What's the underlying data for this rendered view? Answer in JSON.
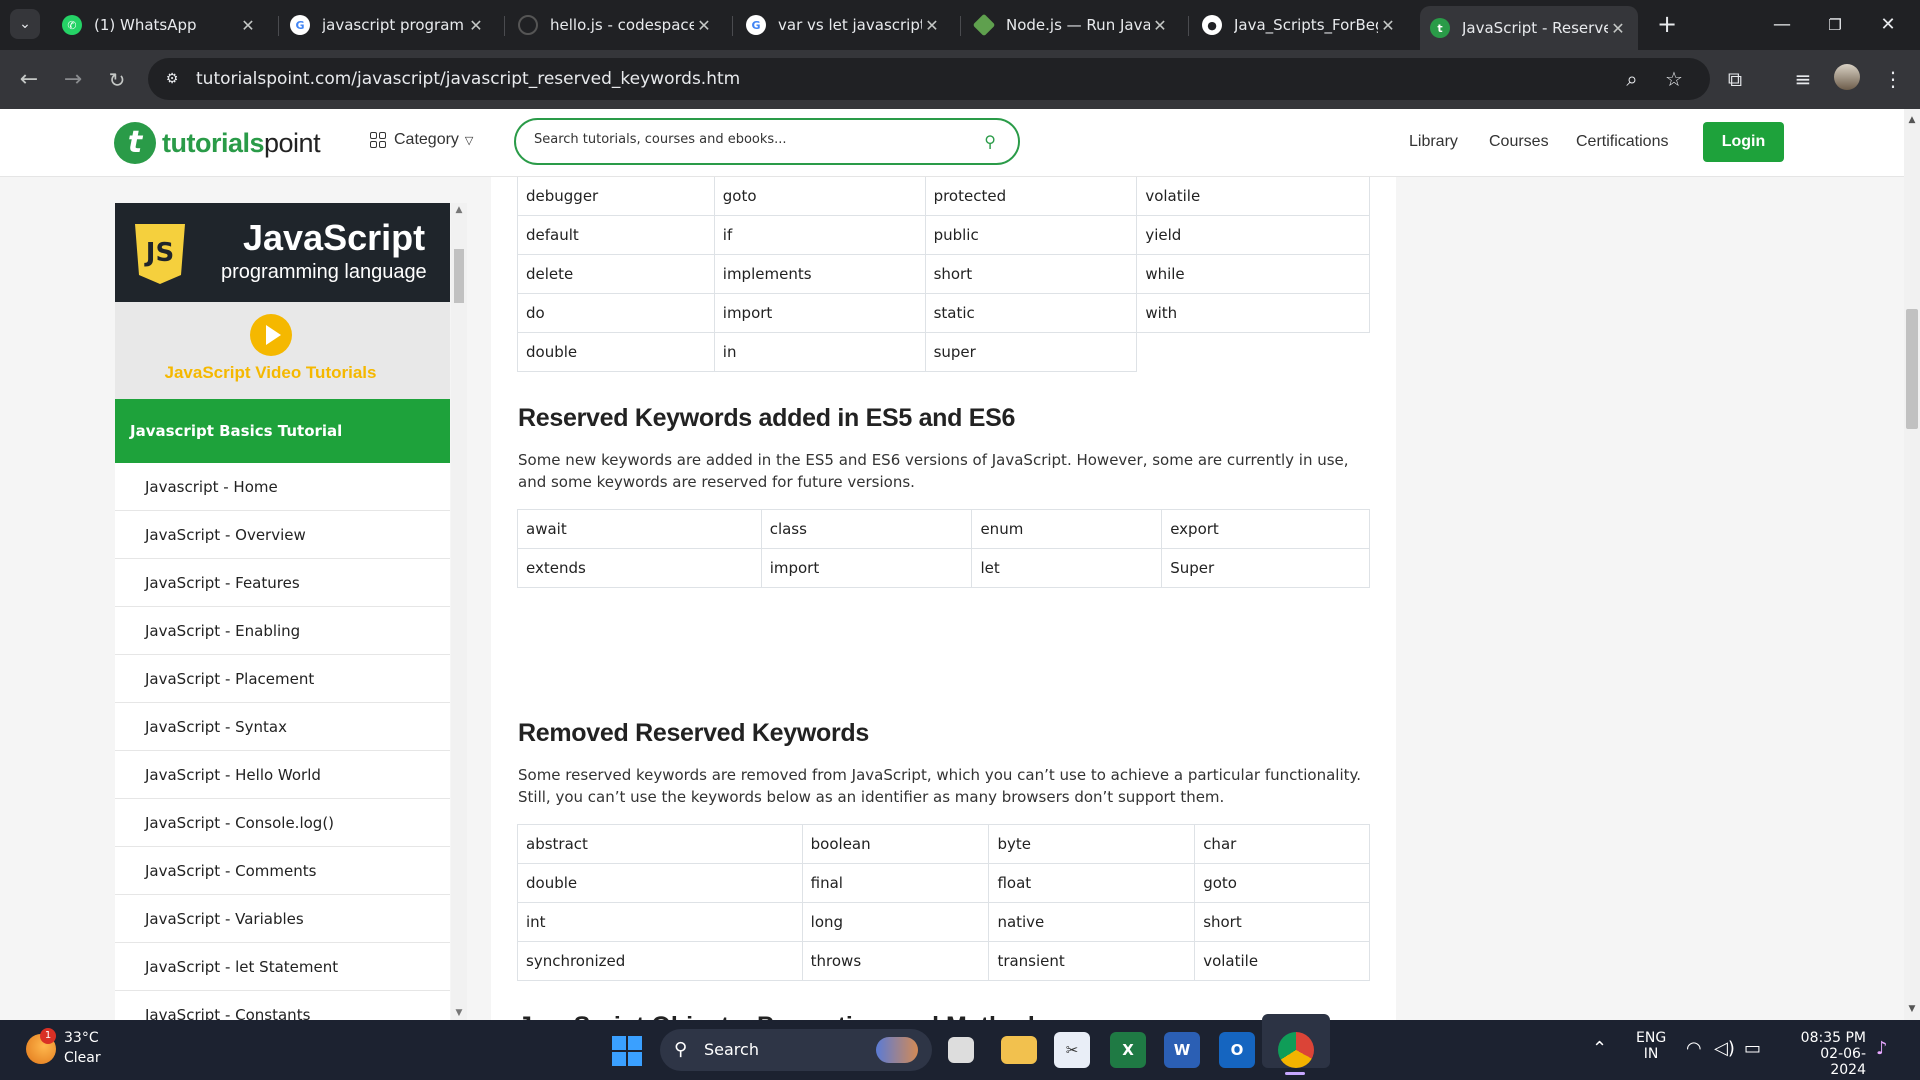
{
  "tabs": [
    {
      "title": "(1) WhatsApp",
      "icon": "whatsapp-icon",
      "color": "#25d366"
    },
    {
      "title": "javascript program st",
      "icon": "google-icon",
      "color": "#ffffff"
    },
    {
      "title": "hello.js - codespaces",
      "icon": "github-icon",
      "color": "#202124"
    },
    {
      "title": "var vs let javascript -",
      "icon": "google-icon",
      "color": "#ffffff"
    },
    {
      "title": "Node.js — Run JavaS",
      "icon": "nodejs-icon",
      "color": "#5fa04e"
    },
    {
      "title": "Java_Scripts_ForBegi",
      "icon": "github-icon",
      "color": "#ffffff"
    },
    {
      "title": "JavaScript - Reserved",
      "icon": "tutorialspoint-icon",
      "color": "#2a9b48"
    }
  ],
  "address": {
    "url": "tutorialspoint.com/javascript/javascript_reserved_keywords.htm"
  },
  "header": {
    "logo_bold": "tutorials",
    "logo_light": "point",
    "logo_mark": "t",
    "category": "Category",
    "search_placeholder": "Search tutorials, courses and ebooks...",
    "nav": [
      "Library",
      "Courses",
      "Certifications"
    ],
    "login": "Login",
    "brand_color": "#1ea23b"
  },
  "sidebar": {
    "banner_title": "JavaScript",
    "banner_sub": "programming language",
    "banner_badge": "JS",
    "video_label": "JavaScript Video Tutorials",
    "section_title": "Javascript Basics Tutorial",
    "items": [
      "Javascript - Home",
      "JavaScript - Overview",
      "JavaScript - Features",
      "JavaScript - Enabling",
      "JavaScript - Placement",
      "JavaScript - Syntax",
      "JavaScript - Hello World",
      "JavaScript - Console.log()",
      "JavaScript - Comments",
      "JavaScript - Variables",
      "JavaScript - let Statement",
      "JavaScript - Constants"
    ]
  },
  "content": {
    "top_table": [
      [
        "debugger",
        "goto",
        "protected",
        "volatile"
      ],
      [
        "default",
        "if",
        "public",
        "yield"
      ],
      [
        "delete",
        "implements",
        "short",
        "while"
      ],
      [
        "do",
        "import",
        "static",
        "with"
      ],
      [
        "double",
        "in",
        "super",
        ""
      ]
    ],
    "es_heading": "Reserved Keywords added in ES5 and ES6",
    "es_text": "Some new keywords are added in the ES5 and ES6 versions of JavaScript. However, some are currently in use, and some keywords are reserved for future versions.",
    "es_table": [
      [
        "await",
        "class",
        "enum",
        "export"
      ],
      [
        "extends",
        "import",
        "let",
        "Super"
      ]
    ],
    "removed_heading": "Removed Reserved Keywords",
    "removed_text": "Some reserved keywords are removed from JavaScript, which you can’t use to achieve a particular functionality. Still, you can’t use the keywords below as an identifier as many browsers don’t support them.",
    "removed_table": [
      [
        "abstract",
        "boolean",
        "byte",
        "char"
      ],
      [
        "double",
        "final",
        "float",
        "goto"
      ],
      [
        "int",
        "long",
        "native",
        "short"
      ],
      [
        "synchronized",
        "throws",
        "transient",
        "volatile"
      ]
    ],
    "next_heading": "JavaScript Objects, Properties, and Methods"
  },
  "taskbar": {
    "temp": "33°C",
    "condition": "Clear",
    "weather_badge": "1",
    "search": "Search",
    "lang1": "ENG",
    "lang2": "IN",
    "time": "08:35 PM",
    "date": "02-06-2024"
  }
}
